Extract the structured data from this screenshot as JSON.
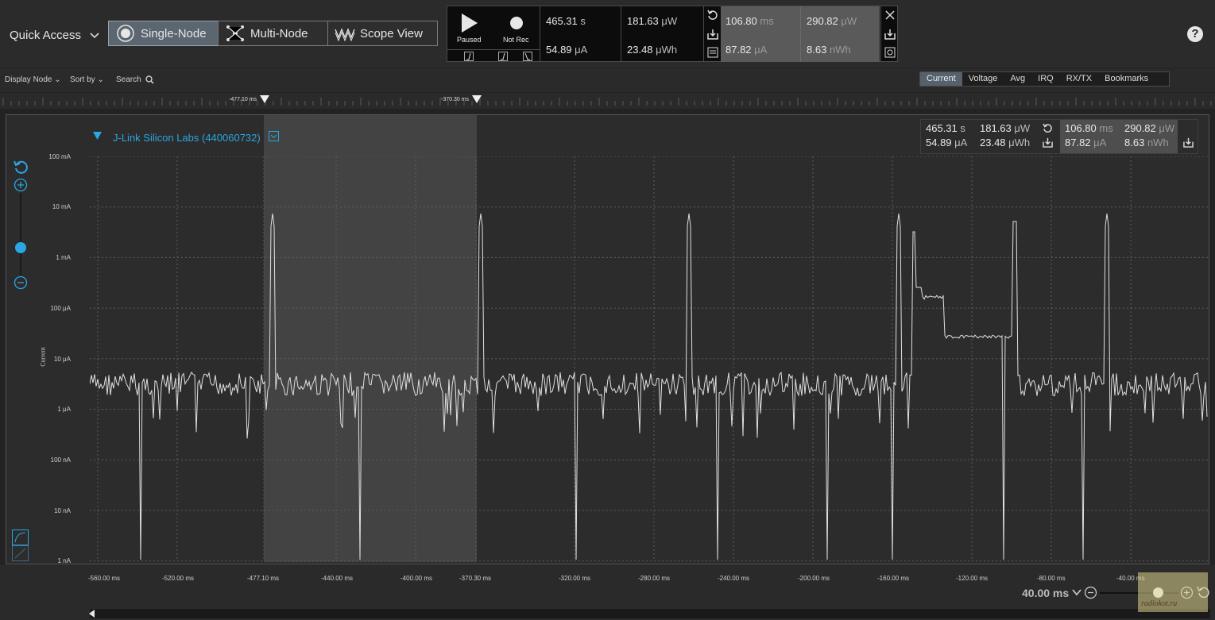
{
  "toolbar": {
    "quick_access": "Quick Access",
    "modes": [
      "Single-Node",
      "Multi-Node",
      "Scope View"
    ],
    "help": "?"
  },
  "live": {
    "play_label": "Paused",
    "rec_label": "Not Rec",
    "time": "465.31",
    "time_unit": "s",
    "current": "54.89",
    "current_unit": "μA",
    "power": "181.63",
    "power_unit": "μW",
    "energy": "23.48",
    "energy_unit": "μWh",
    "sel_time": "106.80",
    "sel_time_unit": "ms",
    "sel_current": "87.82",
    "sel_current_unit": "μA",
    "sel_power": "290.82",
    "sel_power_unit": "μW",
    "sel_energy": "8.63",
    "sel_energy_unit": "nWh"
  },
  "bar2": {
    "display_node": "Display Node",
    "sort_by": "Sort by",
    "search": "Search",
    "tabs": [
      "Current",
      "Voltage",
      "Avg",
      "IRQ",
      "RX/TX",
      "Bookmarks"
    ],
    "active_tab": "Current"
  },
  "ruler": {
    "marker1": "-477.10 ms",
    "marker2": "-370.30 ms"
  },
  "plot": {
    "device": "J-Link Silicon Labs (440060732)",
    "ylabel": "Current",
    "yticks": [
      "100 mA",
      "10 mA",
      "1 mA",
      "100 μA",
      "10 μA",
      "1 μA",
      "100 nA",
      "10 nA",
      "1 nA"
    ],
    "xticks": [
      "-560.00 ms",
      "-520.00 ms",
      "-477.10 ms",
      "-440.00 ms",
      "-400.00 ms",
      "-370.30 ms",
      "-320.00 ms",
      "-280.00 ms",
      "-240.00 ms",
      "-200.00 ms",
      "-160.00 ms",
      "-120.00 ms",
      "-80.00 ms",
      "-40.00 ms"
    ]
  },
  "zoom": {
    "label": "40.00 ms"
  },
  "watermark": "radiokot.ru",
  "colors": {
    "accent": "#2aa6e3",
    "trace": "#e0e0e0",
    "selection": "#4a4a4a"
  }
}
